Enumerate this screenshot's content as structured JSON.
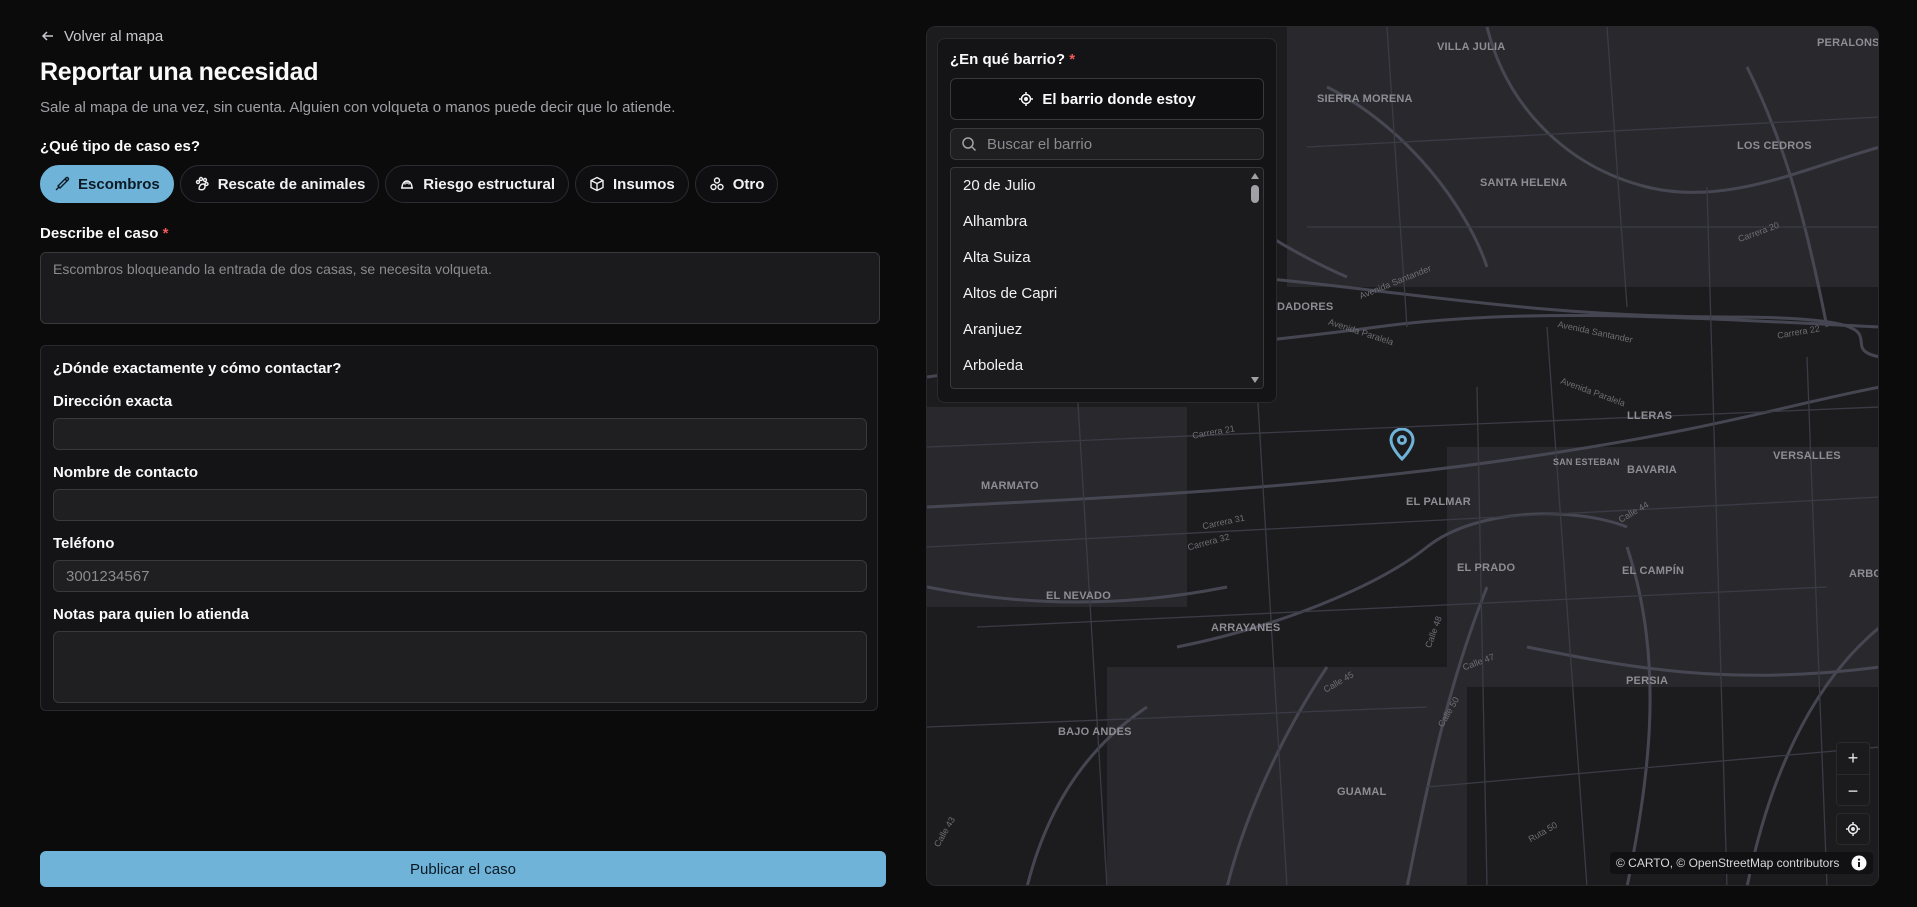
{
  "nav": {
    "back_label": "Volver al mapa"
  },
  "page": {
    "title": "Reportar una necesidad",
    "subtitle": "Sale al mapa de una vez, sin cuenta. Alguien con volqueta o manos puede decir que lo atiende."
  },
  "case_type": {
    "label": "¿Qué tipo de caso es?",
    "options": [
      {
        "label": "Escombros",
        "icon": "shovel-icon",
        "selected": true
      },
      {
        "label": "Rescate de animales",
        "icon": "paw-icon",
        "selected": false
      },
      {
        "label": "Riesgo estructural",
        "icon": "helmet-icon",
        "selected": false
      },
      {
        "label": "Insumos",
        "icon": "box-icon",
        "selected": false
      },
      {
        "label": "Otro",
        "icon": "circles-icon",
        "selected": false
      }
    ]
  },
  "description": {
    "label": "Describe el caso",
    "required_mark": "*",
    "placeholder": "Escombros bloqueando la entrada de dos casas, se necesita volqueta."
  },
  "contact": {
    "title": "¿Dónde exactamente y cómo contactar?",
    "address_label": "Dirección exacta",
    "name_label": "Nombre de contacto",
    "phone_label": "Teléfono",
    "phone_placeholder": "3001234567",
    "notes_label": "Notas para quien lo atienda"
  },
  "submit_label": "Publicar el caso",
  "neighborhood": {
    "title": "¿En qué barrio?",
    "required_mark": "*",
    "locate_label": "El barrio donde estoy",
    "search_placeholder": "Buscar el barrio",
    "items": [
      "20 de Julio",
      "Alhambra",
      "Alta Suiza",
      "Altos de Capri",
      "Aranjuez",
      "Arboleda"
    ]
  },
  "map": {
    "area_labels": [
      "VILLA JULIA",
      "PERALONSO",
      "SIERRA MORENA",
      "LOS CEDROS",
      "SANTA HELENA",
      "DADORES",
      "LLERAS",
      "SAN ESTEBAN",
      "BAVARIA",
      "VERSALLES",
      "MARMATO",
      "EL PALMAR",
      "EL PRADO",
      "EL CAMPÍN",
      "ARBO",
      "EL NEVADO",
      "ARRAYANES",
      "PERSIA",
      "BAJO ANDES",
      "GUAMAL"
    ],
    "street_labels": [
      "Avenida Santander",
      "Avenida Paralela",
      "Carrera 20",
      "Carrera 22",
      "Carrera 21",
      "Calle 48",
      "Calle 45",
      "Calle 47",
      "Calle 50",
      "Carrera 32",
      "Carrera 31",
      "Calle 44",
      "Calle 43",
      "Ruta 50"
    ],
    "zoom_in": "+",
    "zoom_out": "−",
    "attribution": "© CARTO, © OpenStreetMap contributors",
    "accent_color": "#6fb3d8"
  }
}
